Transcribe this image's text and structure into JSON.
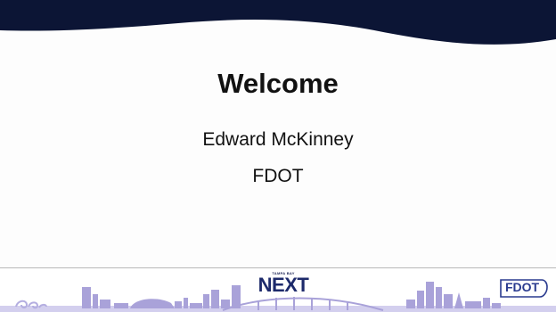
{
  "slide": {
    "title": "Welcome",
    "presenter": "Edward McKinney",
    "organization": "FDOT"
  },
  "footer": {
    "logo_center": {
      "small_text": "TAMPA BAY",
      "word": "NEXT"
    },
    "logo_right": {
      "word": "FDOT"
    },
    "icons": [
      "wave-swirl-icon",
      "city-skyline-icon",
      "bridge-icon"
    ]
  },
  "colors": {
    "header_navy": "#0c1535",
    "skyline_lavender": "#a9a2d9",
    "skyline_light": "#d3cfee",
    "logo_navy": "#1d2a6b",
    "text": "#111111"
  }
}
